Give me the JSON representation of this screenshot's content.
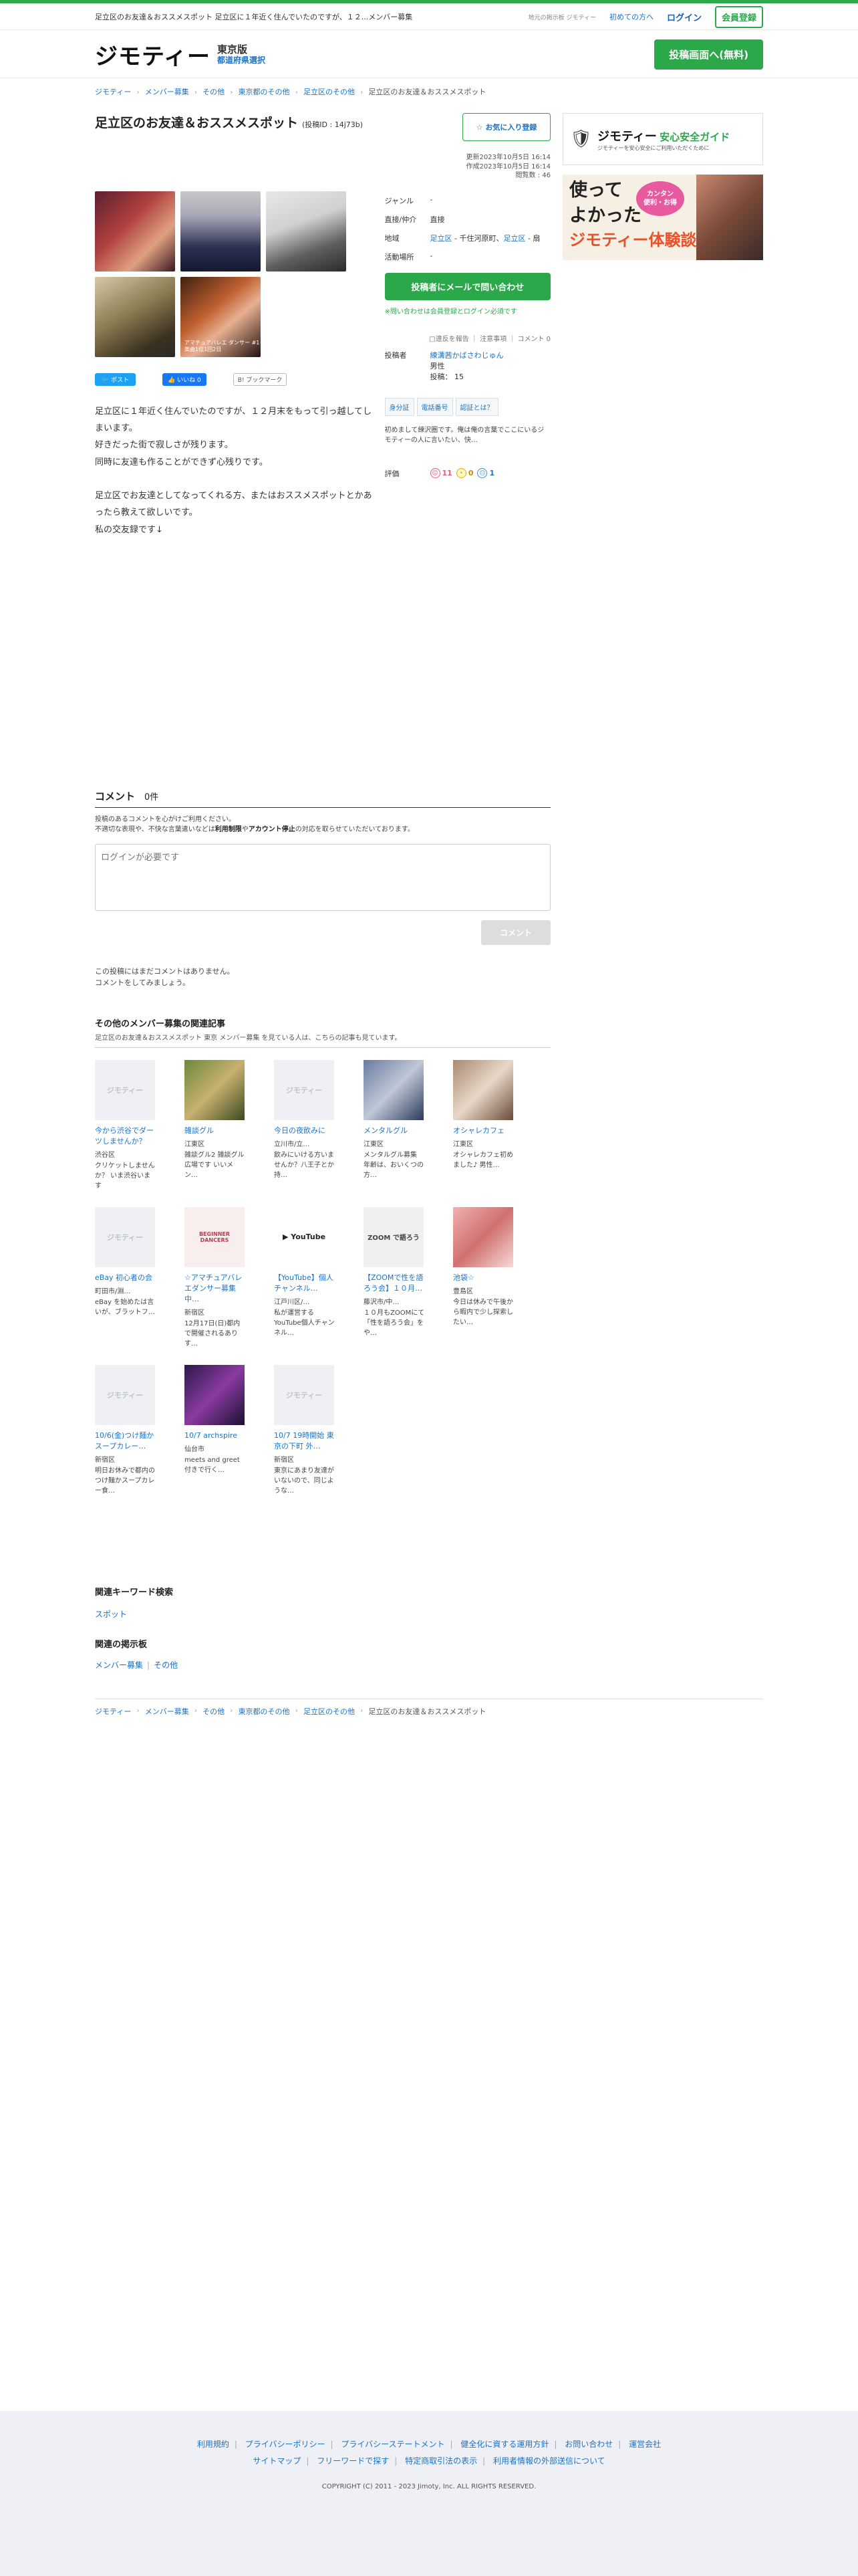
{
  "topbar": {
    "description": "足立区のお友達＆おススメスポット 足立区に１年近く住んでいたのですが、１２...メンバー募集",
    "local_info": "地元の掲示板 ジモティー",
    "beginners": "初めての方へ",
    "login": "ログイン",
    "register": "会員登録"
  },
  "header": {
    "logo": "ジモティー",
    "pref": "東京版",
    "pref_select": "都道府県選択",
    "post_button": "投稿画面へ(無料)"
  },
  "breadcrumb": [
    "ジモティー",
    "メンバー募集",
    "その他",
    "東京都のその他",
    "足立区のその他",
    "足立区のお友達＆おススメスポット"
  ],
  "post": {
    "title": "足立区のお友達＆おススメスポット",
    "post_id": "(投稿ID : 14j73b)",
    "fav_button": "お気に入り登録",
    "updated": "更新2023年10月5日 16:14",
    "created": "作成2023年10月5日 16:14",
    "views": "閲覧数 : 46",
    "photo_caption": "アマチュアバレエ\nダンサー\n#1楽曲1位1回2日",
    "share_tweet": "ポスト",
    "share_like": "いいね 0",
    "share_hatena": "B! ブックマーク",
    "body": [
      "足立区に１年近く住んでいたのですが、１２月末をもって引っ越してしまいます。",
      "好きだった街で寂しさが残ります。",
      "同時に友達も作ることができず心残りです。",
      "",
      "足立区でお友達としてなってくれる方、またはおススメスポットとかあったら教えて欲しいです。",
      "私の交友録です↓"
    ]
  },
  "info": {
    "genre_label": "ジャンル",
    "genre": "-",
    "direct_label": "直接/仲介",
    "direct": "直接",
    "area_label": "地域",
    "area_pre": "足立区",
    "area_mid": " - 千住河原町、",
    "area_link": "足立区",
    "area_post": " - 扇",
    "place_label": "活動場所",
    "place": "-",
    "inquiry_button": "投稿者にメールで問い合わせ",
    "inquiry_note": "※問い合わせは会員登録とログイン必須です",
    "report": "□違反を報告 ｜ 注意事項 ｜ コメント 0",
    "poster_label": "投稿者",
    "poster_name": "練溝茜かばさわじゅん",
    "poster_gender": "男性",
    "poster_posts": "投稿： 15",
    "badge1": "身分証",
    "badge2": "電話番号",
    "badge3": "認証とは？",
    "intro": "初めまして練沢圏です。俺は俺の言葉でここにいるジモティーの人に言いたい、快…",
    "eval_label": "評価",
    "eval_good": "11",
    "eval_mid": "0",
    "eval_bad": "1"
  },
  "side": {
    "banner1_title": "ジモティー",
    "banner1_tag": "安心安全ガイド",
    "banner1_sub": "ジモティーを安心安全にご利用いただくために",
    "banner2_l1": "使って",
    "banner2_l2": "よかった",
    "banner2_l3": "ジモティー体験談",
    "banner2_badge": "カンタン\n便利・お得"
  },
  "comments": {
    "heading": "コメント",
    "count": "0件",
    "note1": "投稿のあるコメントを心がけご利用ください。",
    "note2_pre": "不適切な表現や、不快な言葉遣いなどは",
    "note2_b1": "利用制限",
    "note2_mid": "や",
    "note2_b2": "アカウント停止",
    "note2_post": "の対応を取らせていただいております。",
    "placeholder": "ログインが必要です",
    "submit": "コメント",
    "empty1": "この投稿にはまだコメントはありません。",
    "empty2": "コメントをしてみましょう。"
  },
  "related": {
    "heading": "その他のメンバー募集の関連記事",
    "sub": "足立区のお友達＆おススメスポット 東京 メンバー募集 を見ている人は、こちらの記事も見ています。",
    "items": [
      {
        "title": "今から渋谷でダーツしませんか？",
        "loc": "渋谷区",
        "desc": "クリケットしませんか？ いま渋谷います",
        "thumb": "jm",
        "label": "ジモティー"
      },
      {
        "title": "雑談グル",
        "loc": "江東区",
        "desc": "雑談グル2 雑談グル広場です いいメン…",
        "thumb": "food1",
        "label": ""
      },
      {
        "title": "今日の夜飲みに",
        "loc": "立川市/立…",
        "desc": "飲みにいける方いませんか？八王子とか持…",
        "thumb": "jm",
        "label": "ジモティー"
      },
      {
        "title": "メンタルグル",
        "loc": "江東区",
        "desc": "メンタルグル募集 年齢は、おいくつの方…",
        "thumb": "photo2",
        "label": ""
      },
      {
        "title": "オシャレカフェ",
        "loc": "江東区",
        "desc": "オシャレカフェ初めました♪ 男性…",
        "thumb": "cafe",
        "label": ""
      },
      {
        "title": "eBay 初心者の会",
        "loc": "町田市/淵…",
        "desc": "eBay を始めたは言いが、ブラットフ…",
        "thumb": "ebay",
        "label": "ジモティー"
      },
      {
        "title": "☆アマチュアバレエダンサー募集中…",
        "loc": "新宿区",
        "desc": "12月17日(日)都内で開催されるありす…",
        "thumb": "event",
        "label": "BEGINNER\nDANCERS"
      },
      {
        "title": "【YouTube】個人チャンネル…",
        "loc": "江戸川区/…",
        "desc": "私が運営するYouTube個人チャンネル…",
        "thumb": "yt",
        "label": "▶ YouTube"
      },
      {
        "title": "【ZOOMで性を語ろう会】１０月…",
        "loc": "藤沢市/中…",
        "desc": "１０月もZOOMにて「性を語ろう会」をや…",
        "thumb": "zoom",
        "label": "ZOOM で語ろう"
      },
      {
        "title": "池袋☆",
        "loc": "豊島区",
        "desc": "今日は休みで午後から暇内で少し探索したい…",
        "thumb": "pink",
        "label": ""
      },
      {
        "title": "10/6(金)つけ麺かスープカレー…",
        "loc": "新宿区",
        "desc": "明日お休みで都内のつけ麺かスープカレー食…",
        "thumb": "jm",
        "label": "ジモティー"
      },
      {
        "title": "10/7 archspire",
        "loc": "仙台市",
        "desc": "meets and greet 付きで行く…",
        "thumb": "concert",
        "label": ""
      },
      {
        "title": "10/7 19時開始 東京の下町 外…",
        "loc": "新宿区",
        "desc": "東京にあまり友達がいないので、同じような…",
        "thumb": "jm",
        "label": "ジモティー"
      }
    ]
  },
  "keywords": {
    "heading": "関連キーワード検索",
    "link": "スポット",
    "board_heading": "関連の掲示板",
    "board_links": [
      "メンバー募集",
      "その他"
    ]
  },
  "footer": {
    "row1": [
      "利用規約",
      "プライバシーポリシー",
      "プライバシーステートメント",
      "健全化に資する運用方針",
      "お問い合わせ",
      "運営会社"
    ],
    "row2": [
      "サイトマップ",
      "フリーワードで探す",
      "特定商取引法の表示",
      "利用者情報の外部送信について"
    ],
    "copyright": "COPYRIGHT (C) 2011 - 2023 Jimoty, Inc. ALL RIGHTS RESERVED."
  }
}
